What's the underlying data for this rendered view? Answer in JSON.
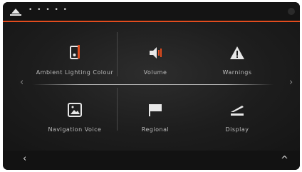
{
  "statusbar": {
    "title": "• • • • •",
    "app_icon": "up-arrow-icon"
  },
  "tiles": [
    {
      "label": "Ambient Lighting Colour",
      "icon": "phone-orange-icon"
    },
    {
      "label": "Volume",
      "icon": "speaker-orange-icon"
    },
    {
      "label": "Warnings",
      "icon": "warning-triangle-icon"
    },
    {
      "label": "Navigation Voice",
      "icon": "picture-frame-icon"
    },
    {
      "label": "Regional",
      "icon": "flag-icon"
    },
    {
      "label": "Display",
      "icon": "brightness-icon"
    }
  ],
  "nav": {
    "left": "‹",
    "right": "›",
    "back": "‹",
    "up": "^"
  },
  "colors": {
    "accent": "#e24c1e",
    "background": "#101010"
  }
}
